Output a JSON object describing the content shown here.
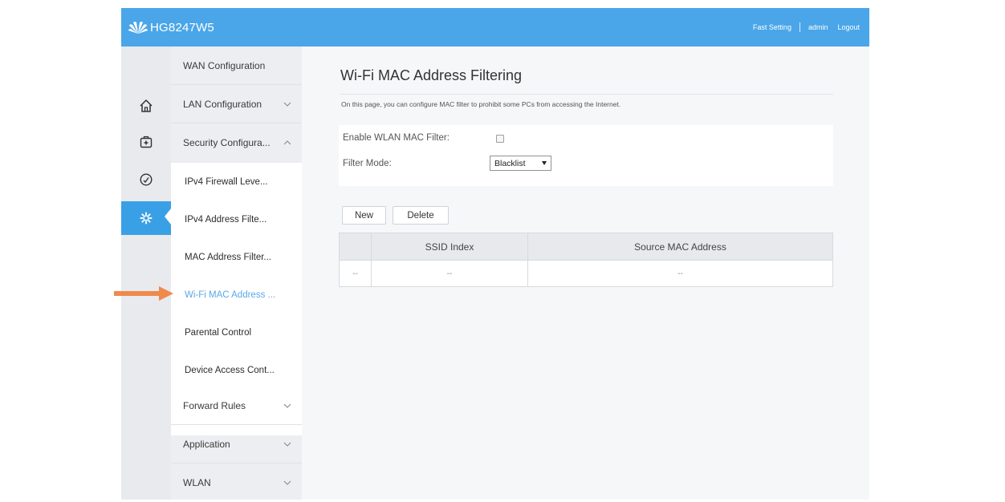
{
  "header": {
    "product_name": "HG8247W5",
    "fast_setting": "Fast Setting",
    "user": "admin",
    "logout": "Logout"
  },
  "rail": {
    "items": [
      {
        "icon": "home-icon"
      },
      {
        "icon": "first-aid-icon"
      },
      {
        "icon": "gauge-icon"
      },
      {
        "icon": "gear-icon",
        "active": true
      }
    ]
  },
  "sidebar": {
    "items": [
      {
        "label": "WAN Configuration"
      },
      {
        "label": "LAN Configuration"
      },
      {
        "label": "Security Configura..."
      },
      {
        "label": "Forward Rules"
      },
      {
        "label": "Application"
      },
      {
        "label": "WLAN"
      }
    ],
    "security_subitems": [
      {
        "label": "IPv4 Firewall Leve..."
      },
      {
        "label": "IPv4 Address Filte..."
      },
      {
        "label": "MAC Address Filter..."
      },
      {
        "label": "Wi-Fi MAC Address ..."
      },
      {
        "label": "Parental Control"
      },
      {
        "label": "Device Access Cont..."
      }
    ]
  },
  "main": {
    "title": "Wi-Fi MAC Address Filtering",
    "description": "On this page, you can configure MAC filter to prohibit some PCs from accessing the Internet.",
    "form": {
      "enable_label": "Enable WLAN MAC Filter:",
      "mode_label": "Filter Mode:",
      "mode_value": "Blacklist"
    },
    "buttons": {
      "new": "New",
      "delete": "Delete"
    },
    "table": {
      "headers": [
        "",
        "SSID Index",
        "Source MAC Address"
      ],
      "rows": [
        [
          "--",
          "--",
          "--"
        ]
      ]
    }
  },
  "colors": {
    "header_blue": "#4aa6e8",
    "active_blue": "#3aa0e6",
    "active_text": "#59a8ea",
    "arrow_orange": "#ef8a4c"
  }
}
